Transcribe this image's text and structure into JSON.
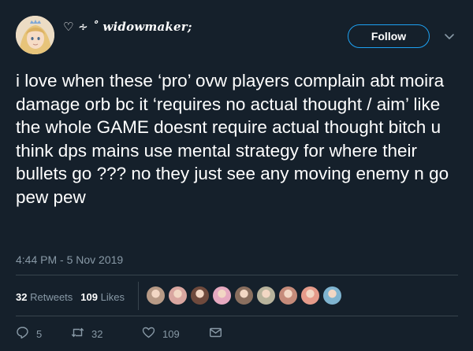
{
  "user": {
    "display_name": "♡ ∻ ˚ widowmaker;",
    "avatar": "profile-avatar"
  },
  "header": {
    "follow_label": "Follow",
    "caret_icon": "chevron-down-icon"
  },
  "tweet": {
    "text": "i love when these ‘pro’ ovw players complain abt moira damage orb bc it ‘requires no actual thought / aim’ like the whole GAME doesnt require actual thought bitch u think dps mains use mental strategy for where their bullets go ??? no they just see any moving enemy n go pew pew",
    "timestamp": "4:44 PM - 5 Nov 2019"
  },
  "stats": {
    "retweets_count": "32",
    "retweets_label": "Retweets",
    "likes_count": "109",
    "likes_label": "Likes"
  },
  "likers": [
    "#b79a86",
    "#d9a6a0",
    "#6f4a3d",
    "#e6a9c0",
    "#8a6f5f",
    "#b8b39c",
    "#c58b7a",
    "#e59b8a",
    "#7fb4d0"
  ],
  "actions": {
    "reply_count": "5",
    "retweet_count": "32",
    "like_count": "109"
  },
  "colors": {
    "background": "#15202b",
    "accent": "#1da1f2",
    "secondary_text": "#8899a6",
    "divider": "#38444d"
  }
}
